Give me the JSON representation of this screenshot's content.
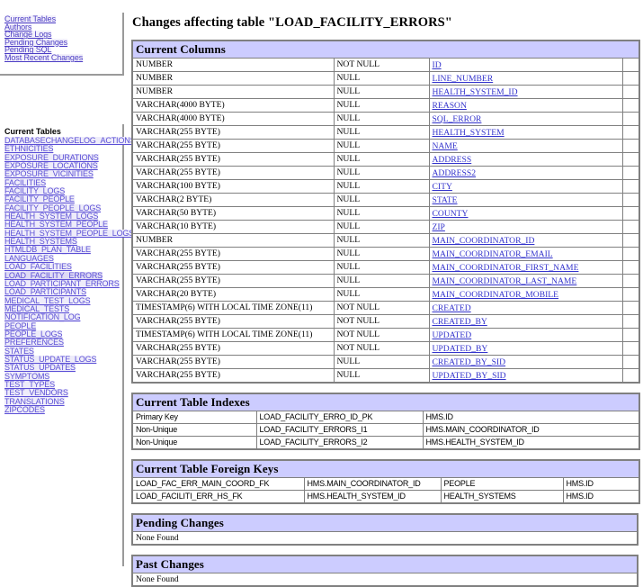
{
  "page": {
    "title": "Changes affecting table \"LOAD_FACILITY_ERRORS\"",
    "header_band_color": "#ccccff",
    "link_color": "#3333cc",
    "nav_link_color": "#4b3cc4"
  },
  "sidebar": {
    "quick_links": [
      {
        "label": "Current Tables"
      },
      {
        "label": "Authors"
      },
      {
        "label": "Change Logs"
      },
      {
        "label": "Pending Changes"
      },
      {
        "label": "Pending SQL"
      },
      {
        "label": "Most Recent Changes"
      }
    ],
    "tables_title": "Current Tables",
    "tables": [
      {
        "label": "DATABASECHANGELOG_ACTIONS",
        "current": false
      },
      {
        "label": "ETHNICITIES",
        "current": false
      },
      {
        "label": "EXPOSURE_DURATIONS",
        "current": false
      },
      {
        "label": "EXPOSURE_LOCATIONS",
        "current": false
      },
      {
        "label": "EXPOSURE_VICINITIES",
        "current": false
      },
      {
        "label": "FACILITIES",
        "current": false
      },
      {
        "label": "FACILITY_LOGS",
        "current": false
      },
      {
        "label": "FACILITY_PEOPLE",
        "current": false
      },
      {
        "label": "FACILITY_PEOPLE_LOGS",
        "current": false
      },
      {
        "label": "HEALTH_SYSTEM_LOGS",
        "current": false
      },
      {
        "label": "HEALTH_SYSTEM_PEOPLE",
        "current": false
      },
      {
        "label": "HEALTH_SYSTEM_PEOPLE_LOGS",
        "current": false
      },
      {
        "label": "HEALTH_SYSTEMS",
        "current": false
      },
      {
        "label": "HTMLDB_PLAN_TABLE",
        "current": false
      },
      {
        "label": "LANGUAGES",
        "current": false
      },
      {
        "label": "LOAD_FACILITIES",
        "current": false
      },
      {
        "label": "LOAD_FACILITY_ERRORS",
        "current": true
      },
      {
        "label": "LOAD_PARTICIPANT_ERRORS",
        "current": false
      },
      {
        "label": "LOAD_PARTICIPANTS",
        "current": false
      },
      {
        "label": "MEDICAL_TEST_LOGS",
        "current": false
      },
      {
        "label": "MEDICAL_TESTS",
        "current": false
      },
      {
        "label": "NOTIFICATION_LOG",
        "current": false
      },
      {
        "label": "PEOPLE",
        "current": false
      },
      {
        "label": "PEOPLE_LOGS",
        "current": false
      },
      {
        "label": "PREFERENCES",
        "current": false
      },
      {
        "label": "STATES",
        "current": false
      },
      {
        "label": "STATUS_UPDATE_LOGS",
        "current": false
      },
      {
        "label": "STATUS_UPDATES",
        "current": false
      },
      {
        "label": "SYMPTOMS",
        "current": false
      },
      {
        "label": "TEST_TYPES",
        "current": false
      },
      {
        "label": "TEST_VENDORS",
        "current": false
      },
      {
        "label": "TRANSLATIONS",
        "current": false
      },
      {
        "label": "ZIPCODES",
        "current": false
      }
    ]
  },
  "sections": {
    "current_columns": {
      "heading": "Current Columns",
      "rows": [
        {
          "datatype": "NUMBER",
          "nullable": "NOT NULL",
          "name": "ID",
          "extra": ""
        },
        {
          "datatype": "NUMBER",
          "nullable": "NULL",
          "name": "LINE_NUMBER",
          "extra": ""
        },
        {
          "datatype": "NUMBER",
          "nullable": "NULL",
          "name": "HEALTH_SYSTEM_ID",
          "extra": ""
        },
        {
          "datatype": "VARCHAR(4000 BYTE)",
          "nullable": "NULL",
          "name": "REASON",
          "extra": ""
        },
        {
          "datatype": "VARCHAR(4000 BYTE)",
          "nullable": "NULL",
          "name": "SQL_ERROR",
          "extra": ""
        },
        {
          "datatype": "VARCHAR(255 BYTE)",
          "nullable": "NULL",
          "name": "HEALTH_SYSTEM",
          "extra": ""
        },
        {
          "datatype": "VARCHAR(255 BYTE)",
          "nullable": "NULL",
          "name": "NAME",
          "extra": ""
        },
        {
          "datatype": "VARCHAR(255 BYTE)",
          "nullable": "NULL",
          "name": "ADDRESS",
          "extra": ""
        },
        {
          "datatype": "VARCHAR(255 BYTE)",
          "nullable": "NULL",
          "name": "ADDRESS2",
          "extra": ""
        },
        {
          "datatype": "VARCHAR(100 BYTE)",
          "nullable": "NULL",
          "name": "CITY",
          "extra": ""
        },
        {
          "datatype": "VARCHAR(2 BYTE)",
          "nullable": "NULL",
          "name": "STATE",
          "extra": ""
        },
        {
          "datatype": "VARCHAR(50 BYTE)",
          "nullable": "NULL",
          "name": "COUNTY",
          "extra": ""
        },
        {
          "datatype": "VARCHAR(10 BYTE)",
          "nullable": "NULL",
          "name": "ZIP",
          "extra": ""
        },
        {
          "datatype": "NUMBER",
          "nullable": "NULL",
          "name": "MAIN_COORDINATOR_ID",
          "extra": ""
        },
        {
          "datatype": "VARCHAR(255 BYTE)",
          "nullable": "NULL",
          "name": "MAIN_COORDINATOR_EMAIL",
          "extra": ""
        },
        {
          "datatype": "VARCHAR(255 BYTE)",
          "nullable": "NULL",
          "name": "MAIN_COORDINATOR_FIRST_NAME",
          "extra": ""
        },
        {
          "datatype": "VARCHAR(255 BYTE)",
          "nullable": "NULL",
          "name": "MAIN_COORDINATOR_LAST_NAME",
          "extra": ""
        },
        {
          "datatype": "VARCHAR(20 BYTE)",
          "nullable": "NULL",
          "name": "MAIN_COORDINATOR_MOBILE",
          "extra": ""
        },
        {
          "datatype": "TIMESTAMP(6) WITH LOCAL TIME ZONE(11)",
          "nullable": "NOT NULL",
          "name": "CREATED",
          "extra": ""
        },
        {
          "datatype": "VARCHAR(255 BYTE)",
          "nullable": "NOT NULL",
          "name": "CREATED_BY",
          "extra": ""
        },
        {
          "datatype": "TIMESTAMP(6) WITH LOCAL TIME ZONE(11)",
          "nullable": "NOT NULL",
          "name": "UPDATED",
          "extra": ""
        },
        {
          "datatype": "VARCHAR(255 BYTE)",
          "nullable": "NOT NULL",
          "name": "UPDATED_BY",
          "extra": ""
        },
        {
          "datatype": "VARCHAR(255 BYTE)",
          "nullable": "NULL",
          "name": "CREATED_BY_SID",
          "extra": ""
        },
        {
          "datatype": "VARCHAR(255 BYTE)",
          "nullable": "NULL",
          "name": "UPDATED_BY_SID",
          "extra": ""
        }
      ]
    },
    "current_table_indexes": {
      "heading": "Current Table Indexes",
      "rows": [
        {
          "type": "Primary Key",
          "name": "LOAD_FACILITY_ERRO_ID_PK",
          "columns": "HMS.ID"
        },
        {
          "type": "Non-Unique",
          "name": "LOAD_FACILITY_ERRORS_I1",
          "columns": "HMS.MAIN_COORDINATOR_ID"
        },
        {
          "type": "Non-Unique",
          "name": "LOAD_FACILITY_ERRORS_I2",
          "columns": "HMS.HEALTH_SYSTEM_ID"
        }
      ]
    },
    "current_table_foreign_keys": {
      "heading": "Current Table Foreign Keys",
      "rows": [
        {
          "name": "LOAD_FAC_ERR_MAIN_COORD_FK",
          "column": "HMS.MAIN_COORDINATOR_ID",
          "ref_table": "PEOPLE",
          "ref_column": "HMS.ID"
        },
        {
          "name": "LOAD_FACILITI_ERR_HS_FK",
          "column": "HMS.HEALTH_SYSTEM_ID",
          "ref_table": "HEALTH_SYSTEMS",
          "ref_column": "HMS.ID"
        }
      ]
    },
    "pending_changes": {
      "heading": "Pending Changes",
      "empty_text": "None Found"
    },
    "past_changes": {
      "heading": "Past Changes",
      "empty_text": "None Found"
    }
  }
}
